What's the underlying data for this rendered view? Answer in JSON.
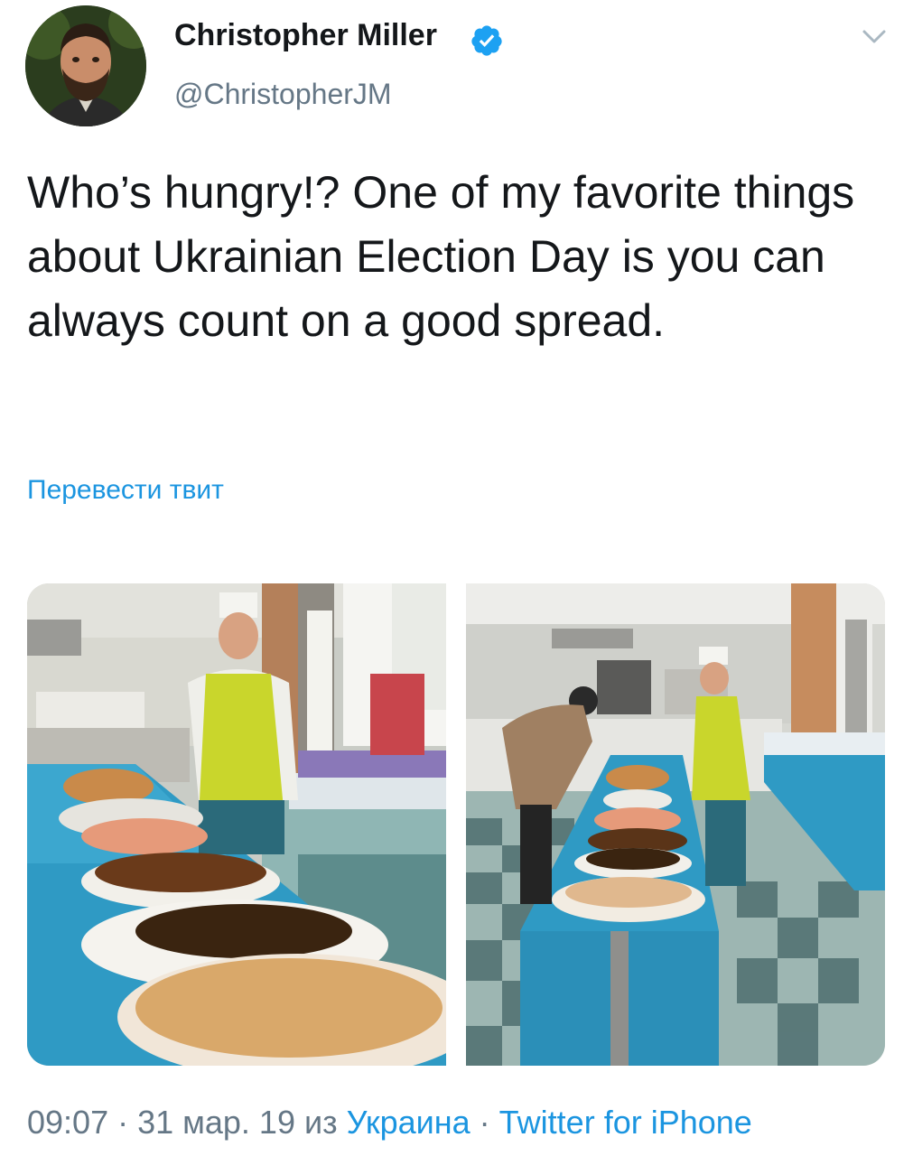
{
  "author": {
    "name": "Christopher Miller",
    "handle": "@ChristopherJM",
    "verified": true,
    "verified_color": "#1da1f2",
    "avatar_icon": "avatar"
  },
  "tweet": {
    "text": "Who’s hungry!? One of my favorite things about Ukrainian Election Day is you can always count on a good spread.",
    "translate_label": "Перевести твит"
  },
  "media": {
    "photos": [
      {
        "icon": "polling-station-buffet-photo"
      },
      {
        "icon": "polling-station-hall-photo"
      }
    ]
  },
  "meta": {
    "time": "09:07",
    "separator_1": " · ",
    "date": "31 мар. 19",
    "from_label": " из ",
    "location": "Украина",
    "separator_2": " · ",
    "source": "Twitter for iPhone"
  },
  "colors": {
    "link": "#1b95e0",
    "secondary_text": "#657786",
    "primary_text": "#14171a"
  }
}
